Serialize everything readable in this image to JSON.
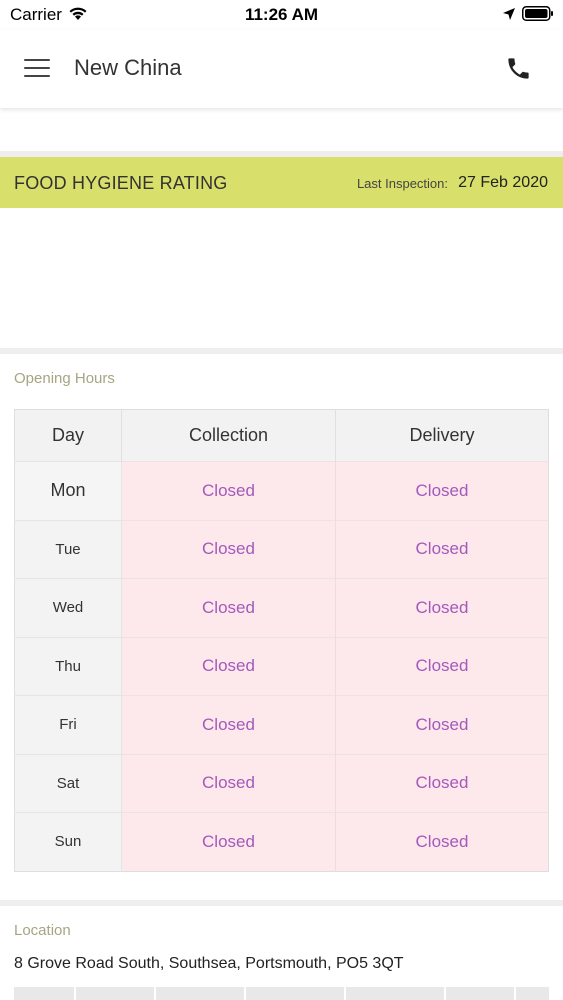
{
  "status_bar": {
    "carrier": "Carrier",
    "time": "11:26 AM",
    "icons": [
      "wifi-icon",
      "location-arrow-icon",
      "battery-icon"
    ]
  },
  "header": {
    "title": "New China",
    "icons": [
      "menu-icon",
      "phone-icon"
    ]
  },
  "hygiene": {
    "title": "FOOD HYGIENE RATING",
    "last_inspection_label": "Last Inspection:",
    "last_inspection_date": "27 Feb 2020",
    "banner_color": "#d8df6a"
  },
  "opening_hours": {
    "label": "Opening Hours",
    "columns": [
      "Day",
      "Collection",
      "Delivery"
    ],
    "rows": [
      {
        "day": "Mon",
        "collection": "Closed",
        "delivery": "Closed"
      },
      {
        "day": "Tue",
        "collection": "Closed",
        "delivery": "Closed"
      },
      {
        "day": "Wed",
        "collection": "Closed",
        "delivery": "Closed"
      },
      {
        "day": "Thu",
        "collection": "Closed",
        "delivery": "Closed"
      },
      {
        "day": "Fri",
        "collection": "Closed",
        "delivery": "Closed"
      },
      {
        "day": "Sat",
        "collection": "Closed",
        "delivery": "Closed"
      },
      {
        "day": "Sun",
        "collection": "Closed",
        "delivery": "Closed"
      }
    ],
    "closed_color": "#a459bb",
    "closed_background": "#fde9ec"
  },
  "location": {
    "label": "Location",
    "address": "8 Grove Road South, Southsea, Portsmouth, PO5 3QT"
  }
}
